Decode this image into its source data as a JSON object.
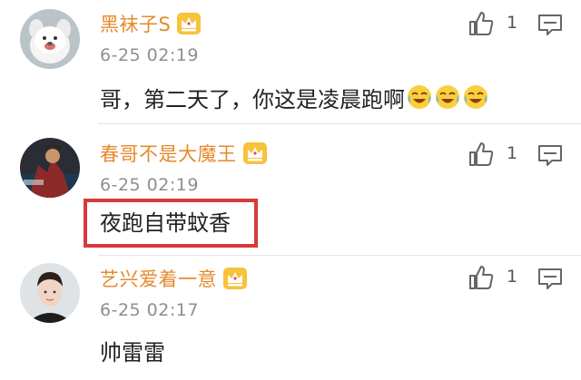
{
  "comments": [
    {
      "username": "黑袜子S",
      "timestamp": "6-25 02:19",
      "text": "哥，第二天了，你这是凌晨跑啊",
      "emojis": [
        "laugh-cry-emoji",
        "laugh-cry-emoji",
        "laugh-cry-emoji"
      ],
      "likes": "1",
      "avatar": "white-dog-avatar"
    },
    {
      "username": "春哥不是大魔王",
      "timestamp": "6-25 02:19",
      "text": "夜跑自带蚊香",
      "likes": "1",
      "avatar": "game-character-avatar"
    },
    {
      "username": "艺兴爱着一意",
      "timestamp": "6-25 02:17",
      "text": "帅雷雷",
      "likes": "1",
      "avatar": "person-avatar"
    }
  ],
  "colors": {
    "username": "#e58a2b",
    "highlight": "#d73a3a",
    "crown": "#f5b324"
  }
}
